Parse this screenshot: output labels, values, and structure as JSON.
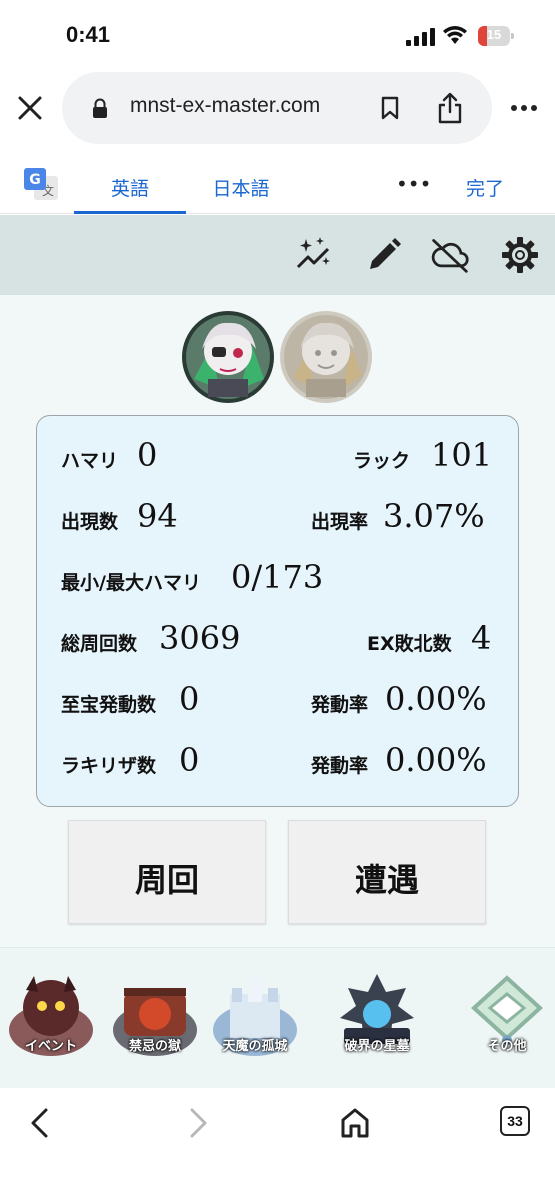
{
  "status_bar": {
    "time": "0:41",
    "battery": "15"
  },
  "browser": {
    "url": "mnst-ex-master.com",
    "tab_count": "33"
  },
  "translate_bar": {
    "lang_source": "英語",
    "lang_target": "日本語",
    "more": "•••",
    "done": "完了"
  },
  "stats": [
    {
      "left_label": "ハマリ",
      "left_value": "0",
      "right_label": "ラック",
      "right_value": "101"
    },
    {
      "left_label": "出現数",
      "left_value": "94",
      "right_label": "出現率",
      "right_value": "3.07%"
    },
    {
      "left_label": "最小/最大ハマリ",
      "left_value": "0/173",
      "right_label": "",
      "right_value": ""
    },
    {
      "left_label": "総周回数",
      "left_value": "3069",
      "right_label": "EX敗北数",
      "right_value": "4"
    },
    {
      "left_label": "至宝発動数",
      "left_value": "0",
      "right_label": "発動率",
      "right_value": "0.00%"
    },
    {
      "left_label": "ラキリザ数",
      "left_value": "0",
      "right_label": "発動率",
      "right_value": "0.00%"
    }
  ],
  "buttons": {
    "lap": "周回",
    "encounter": "遭遇"
  },
  "categories": [
    "イベント",
    "禁忌の獄",
    "天魔の孤城",
    "破界の星墓",
    "その他"
  ],
  "colors": {
    "header_bg": "#d6e3e2",
    "card_bg": "#e6f4fb",
    "accent_blue": "#1a66d2",
    "battery_red": "#e0453b"
  }
}
